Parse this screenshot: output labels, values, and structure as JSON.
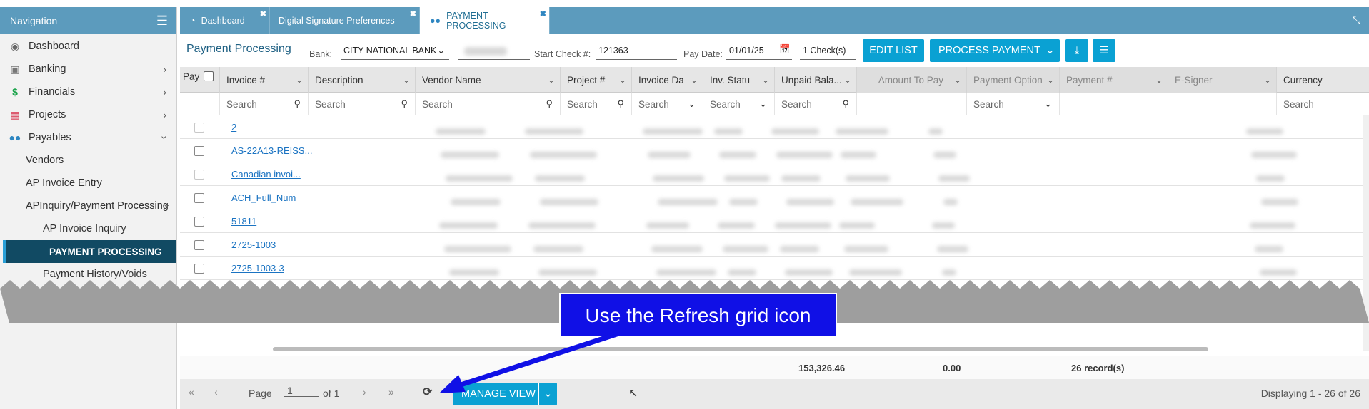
{
  "nav": {
    "title": "Navigation",
    "items": [
      {
        "label": "Dashboard",
        "icon": "palette-icon"
      },
      {
        "label": "Banking",
        "icon": "bank-icon"
      },
      {
        "label": "Financials",
        "icon": "dollar-icon"
      },
      {
        "label": "Projects",
        "icon": "film-icon"
      },
      {
        "label": "Payables",
        "icon": "users-icon"
      }
    ],
    "sub": [
      "Vendors",
      "AP Invoice Entry",
      "APInquiry/Payment Processing"
    ],
    "sub2": [
      "AP Invoice Inquiry",
      "PAYMENT PROCESSING",
      "Payment History/Voids"
    ]
  },
  "tabs": [
    {
      "label": "Dashboard"
    },
    {
      "label": "Digital Signature Preferences"
    },
    {
      "label": "PAYMENT PROCESSING"
    }
  ],
  "toolbar": {
    "title": "Payment Processing",
    "bank_label": "Bank:",
    "bank_value": "CITY NATIONAL BANK",
    "start_check_label": "Start Check #:",
    "start_check_value": "121363",
    "pay_date_label": "Pay Date:",
    "pay_date_value": "01/01/25",
    "checks_value": "1 Check(s)",
    "edit_list": "EDIT LIST",
    "process_payment": "PROCESS PAYMENT"
  },
  "grid": {
    "columns": [
      "Pay",
      "Invoice #",
      "Description",
      "Vendor Name",
      "Project #",
      "Invoice Da",
      "Inv. Statu",
      "Unpaid Bala...",
      "Amount To Pay",
      "Payment Option",
      "Payment #",
      "E-Signer",
      "Currency"
    ],
    "search_placeholder": "Search",
    "rows": [
      "2",
      "AS-22A13-REISS...",
      "Canadian invoi...",
      "ACH_Full_Num",
      "51811",
      "2725-1003",
      "2725-1003-3"
    ]
  },
  "footer": {
    "unpaid_total": "153,326.46",
    "amount_total": "0.00",
    "records": "26 record(s)"
  },
  "pager": {
    "page_label": "Page",
    "page_value": "1",
    "of_label": "of 1",
    "manage_view": "MANAGE VIEW",
    "displaying": "Displaying 1 - 26 of 26"
  },
  "callout": {
    "text": "Use the Refresh grid icon"
  }
}
